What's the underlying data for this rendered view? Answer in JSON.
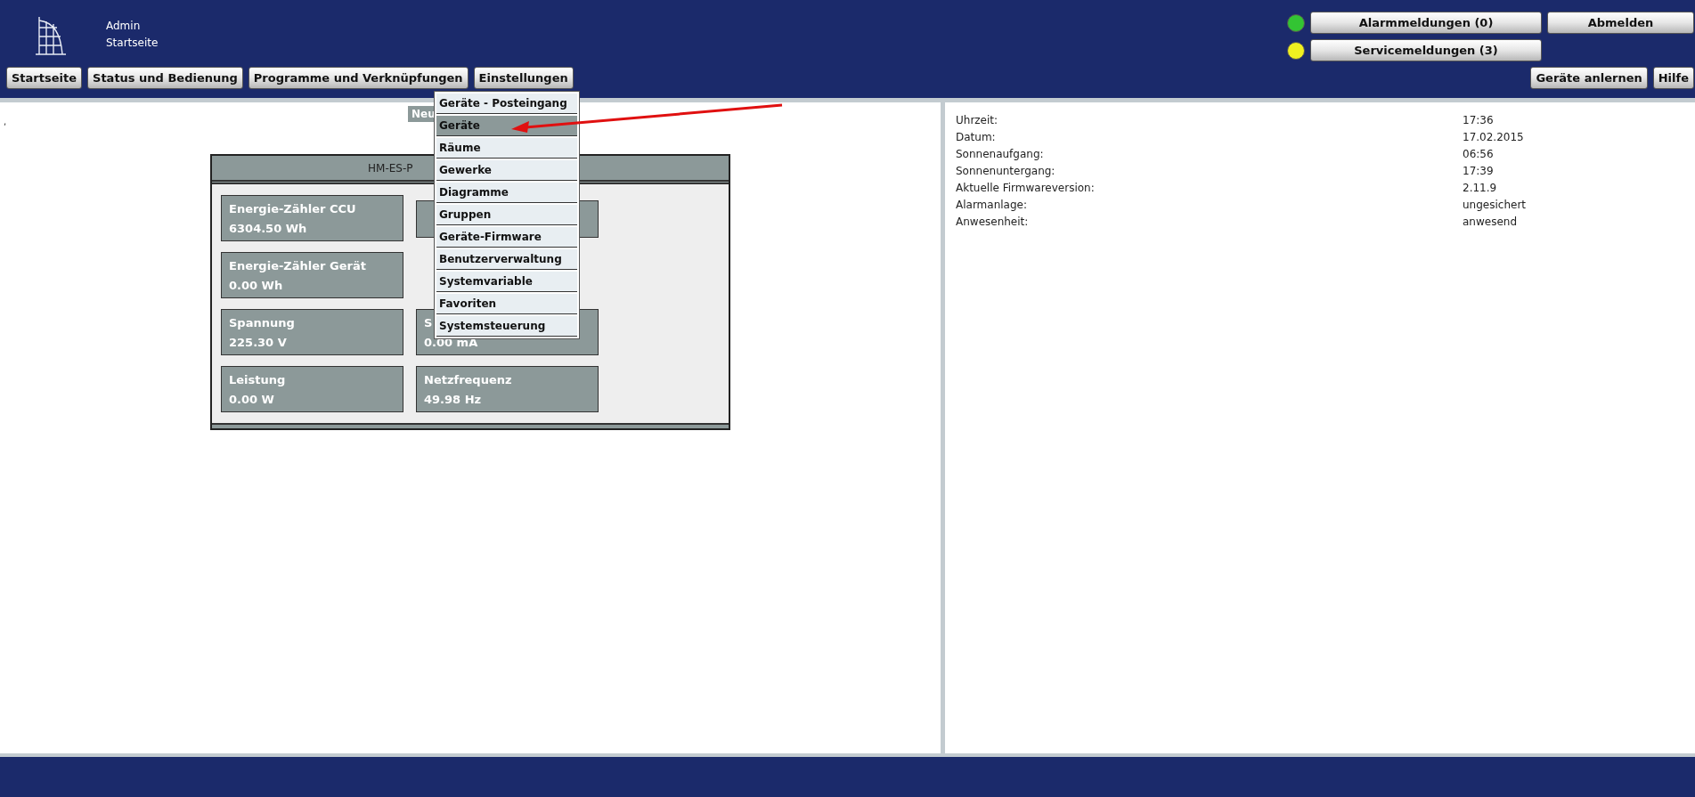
{
  "header": {
    "user": "Admin",
    "page": "Startseite"
  },
  "nav": [
    {
      "label": "Startseite"
    },
    {
      "label": "Status und Bedienung"
    },
    {
      "label": "Programme und Verknüpfungen"
    },
    {
      "label": "Einstellungen"
    }
  ],
  "status": [
    {
      "label": "Alarmmeldungen (0)",
      "color": "#33c433"
    },
    {
      "label": "Servicemeldungen (3)",
      "color": "#f0f020"
    }
  ],
  "logout": "Abmelden",
  "tools": [
    "Geräte anlernen",
    "Hilfe"
  ],
  "menu": [
    {
      "label": "Geräte - Posteingang",
      "selected": false
    },
    {
      "label": "Geräte",
      "selected": true
    },
    {
      "label": "Räume",
      "selected": false
    },
    {
      "label": "Gewerke",
      "selected": false
    },
    {
      "label": "Diagramme",
      "selected": false
    },
    {
      "label": "Gruppen",
      "selected": false
    },
    {
      "label": "Geräte-Firmware",
      "selected": false
    },
    {
      "label": "Benutzerverwaltung",
      "selected": false
    },
    {
      "label": "Systemvariable",
      "selected": false
    },
    {
      "label": "Favoriten",
      "selected": false
    },
    {
      "label": "Systemsteuerung",
      "selected": false
    }
  ],
  "left_mark": ",",
  "new_button": "Neu",
  "device": {
    "title": "HM-ES-P",
    "rows": [
      [
        {
          "kind": "reading",
          "label": "Energie-Zähler CCU",
          "value": "6304.50 Wh"
        },
        {
          "kind": "covered"
        }
      ],
      [
        {
          "kind": "reading",
          "label": "Energie-Zähler Gerät",
          "value": "0.00 Wh"
        }
      ],
      [
        {
          "kind": "reading",
          "label": "Spannung",
          "value": "225.30 V"
        },
        {
          "kind": "reading",
          "label": "S",
          "value": "0.00 mA"
        }
      ],
      [
        {
          "kind": "reading",
          "label": "Leistung",
          "value": "0.00 W"
        },
        {
          "kind": "reading",
          "label": "Netzfrequenz",
          "value": "49.98 Hz"
        }
      ]
    ]
  },
  "info": [
    {
      "label": "Uhrzeit:",
      "value": "17:36"
    },
    {
      "label": "Datum:",
      "value": "17.02.2015"
    },
    {
      "label": "Sonnenaufgang:",
      "value": "06:56"
    },
    {
      "label": "Sonnenuntergang:",
      "value": "17:39"
    },
    {
      "label": "Aktuelle Firmwareversion:",
      "value": "2.11.9"
    },
    {
      "label": "Alarmanlage:",
      "value": "ungesichert"
    },
    {
      "label": "Anwesenheit:",
      "value": "anwesend"
    }
  ]
}
